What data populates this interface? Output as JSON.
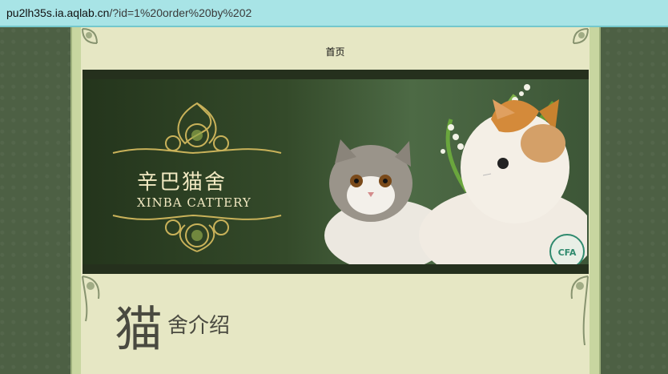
{
  "browser": {
    "url_host": "pu2lh35s.ia.aqlab.cn",
    "url_path": "/?id=1%20order%20by%202"
  },
  "nav": {
    "home_label": "首页"
  },
  "banner": {
    "logo_cn": "辛巴猫舍",
    "logo_en": "XINBA CATTERY"
  },
  "section": {
    "title_big": "猫",
    "title_small": "舍介绍"
  },
  "colors": {
    "address_bar": "#a8e4e6",
    "page_bg": "#4d6044",
    "content_bg": "#e6e7c4",
    "banner_dark": "#1e2a17"
  }
}
